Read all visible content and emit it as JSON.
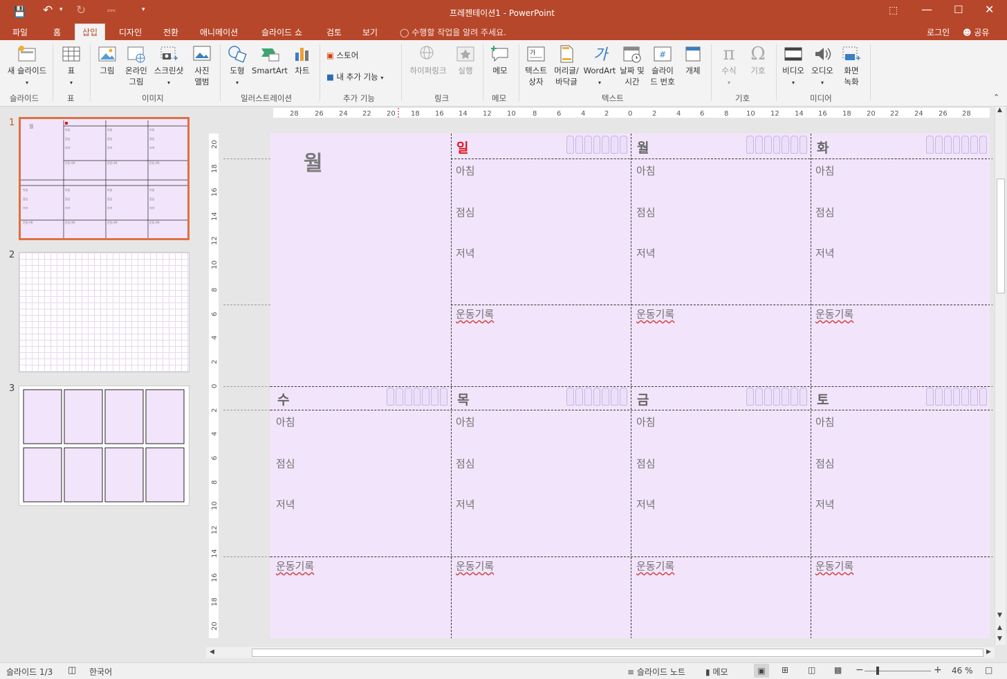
{
  "app": {
    "title": "프레젠테이션1 - PowerPoint"
  },
  "titlebar": {
    "login": "로그인",
    "share": "공유"
  },
  "tabs": [
    "파일",
    "홈",
    "삽입",
    "디자인",
    "전환",
    "애니메이션",
    "슬라이드 쇼",
    "검토",
    "보기"
  ],
  "tell_me": "수행할 작업을 알려 주세요.",
  "ribbon": {
    "new_slide": "새 슬라이드",
    "table": "표",
    "picture": "그림",
    "online_picture": "온라인 그림",
    "screenshot": "스크린샷",
    "photo_album": "사진 앨범",
    "shapes": "도형",
    "smartart": "SmartArt",
    "chart": "차트",
    "store": "스토어",
    "my_addins": "내 추가 기능",
    "hyperlink": "하이퍼링크",
    "action": "실행",
    "comment": "메모",
    "textbox": "텍스트 상자",
    "header_footer": "머리글/ 바닥글",
    "wordart": "WordArt",
    "datetime": "날짜 및 시간",
    "slide_number": "슬라이 드 번호",
    "object": "개체",
    "equation": "수식",
    "symbol": "기호",
    "video": "비디오",
    "audio": "오디오",
    "screen_recording": "화면 녹화",
    "groups": {
      "slides": "슬라이드",
      "tables": "표",
      "images": "이미지",
      "illustrations": "일러스트레이션",
      "addins": "추가 기능",
      "links": "링크",
      "comments": "메모",
      "text": "텍스트",
      "symbols": "기호",
      "media": "미디어"
    }
  },
  "thumbnails": [
    "1",
    "2",
    "3"
  ],
  "slide": {
    "month": "월",
    "days": [
      {
        "name": "일",
        "red": true
      },
      {
        "name": "월",
        "red": false
      },
      {
        "name": "화",
        "red": false
      },
      {
        "name": "수",
        "red": false
      },
      {
        "name": "목",
        "red": false
      },
      {
        "name": "금",
        "red": false
      },
      {
        "name": "토",
        "red": false
      }
    ],
    "meals": [
      "아침",
      "점심",
      "저녁"
    ],
    "exercise": "운동기록"
  },
  "status": {
    "slide": "슬라이드 1/3",
    "language": "한국어",
    "notes": "슬라이드 노트",
    "comments": "메모",
    "zoom": "46 %"
  },
  "colors": {
    "accent": "#b7472a",
    "slide_bg": "#f2e5fb",
    "sunday": "#e0141e"
  }
}
